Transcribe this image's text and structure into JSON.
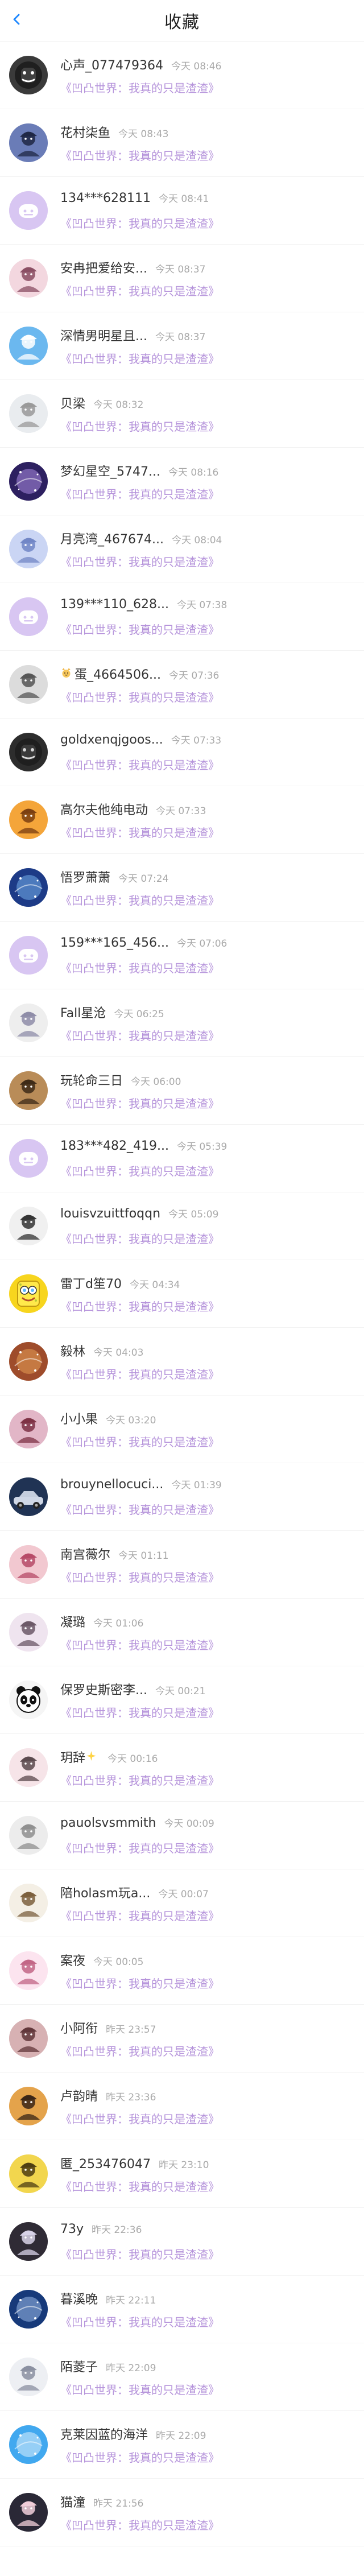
{
  "header": {
    "title": "收藏"
  },
  "items": [
    {
      "name": "心声_077479364",
      "time": "今天 08:46",
      "work": "《凹凸世界：我真的只是渣渣》",
      "avatar": {
        "bg": "#3a3a3a",
        "fg": "#ffffff",
        "style": "black"
      }
    },
    {
      "name": "花村柒鱼",
      "time": "今天 08:43",
      "work": "《凹凸世界：我真的只是渣渣》",
      "avatar": {
        "bg": "#6a7cb7",
        "fg": "#1f2744",
        "style": "anime"
      }
    },
    {
      "name": "134***628111",
      "time": "今天 08:41",
      "work": "《凹凸世界：我真的只是渣渣》",
      "avatar": {
        "bg": "#d8c6f2",
        "fg": "#ffffff",
        "style": "default"
      }
    },
    {
      "name": "安冉把爱给安...",
      "time": "今天 08:37",
      "work": "《凹凸世界：我真的只是渣渣》",
      "avatar": {
        "bg": "#f3d7df",
        "fg": "#8a4e63",
        "style": "anime"
      }
    },
    {
      "name": "深情男明星且...",
      "time": "今天 08:37",
      "work": "《凹凸世界：我真的只是渣渣》",
      "avatar": {
        "bg": "#6bb8ef",
        "fg": "#ffffff",
        "style": "anime"
      }
    },
    {
      "name": "贝梁",
      "time": "今天 08:32",
      "work": "《凹凸世界：我真的只是渣渣》",
      "avatar": {
        "bg": "#e9ecef",
        "fg": "#999999",
        "style": "anime"
      }
    },
    {
      "name": "梦幻星空_5747...",
      "time": "今天 08:16",
      "work": "《凹凸世界：我真的只是渣渣》",
      "avatar": {
        "bg": "#2d2060",
        "fg": "#c7a4ff",
        "style": "space"
      }
    },
    {
      "name": "月亮湾_467674...",
      "time": "今天 08:04",
      "work": "《凹凸世界：我真的只是渣渣》",
      "avatar": {
        "bg": "#cad5f4",
        "fg": "#7186c5",
        "style": "anime"
      }
    },
    {
      "name": "139***110_628...",
      "time": "今天 07:38",
      "work": "《凹凸世界：我真的只是渣渣》",
      "avatar": {
        "bg": "#d8c6f2",
        "fg": "#ffffff",
        "style": "default"
      }
    },
    {
      "name": "蛋_4664506...",
      "time": "今天 07:36",
      "work": "《凹凸世界：我真的只是渣渣》",
      "avatar": {
        "bg": "#dcdcdc",
        "fg": "#555555",
        "style": "anime"
      },
      "emoji": true
    },
    {
      "name": "goldxenqjgoos...",
      "time": "今天 07:33",
      "work": "《凹凸世界：我真的只是渣渣》",
      "avatar": {
        "bg": "#2d2d2d",
        "fg": "#d6d6d6",
        "style": "black"
      }
    },
    {
      "name": "高尔夫他纯电动",
      "time": "今天 07:33",
      "work": "《凹凸世界：我真的只是渣渣》",
      "avatar": {
        "bg": "#f4a53a",
        "fg": "#7a3e11",
        "style": "anime"
      }
    },
    {
      "name": "悟罗萧萧",
      "time": "今天 07:24",
      "work": "《凹凸世界：我真的只是渣渣》",
      "avatar": {
        "bg": "#1d3b87",
        "fg": "#88c8ff",
        "style": "space"
      }
    },
    {
      "name": "159***165_456...",
      "time": "今天 07:06",
      "work": "《凹凸世界：我真的只是渣渣》",
      "avatar": {
        "bg": "#d8c6f2",
        "fg": "#ffffff",
        "style": "default"
      }
    },
    {
      "name": "Fall星沧",
      "time": "今天 06:25",
      "work": "《凹凸世界：我真的只是渣渣》",
      "avatar": {
        "bg": "#eeeeee",
        "fg": "#8e8ca8",
        "style": "anime"
      }
    },
    {
      "name": "玩轮命三日",
      "time": "今天 06:00",
      "work": "《凹凸世界：我真的只是渣渣》",
      "avatar": {
        "bg": "#b98c58",
        "fg": "#3d2a17",
        "style": "anime"
      }
    },
    {
      "name": "183***482_419...",
      "time": "今天 05:39",
      "work": "《凹凸世界：我真的只是渣渣》",
      "avatar": {
        "bg": "#d8c6f2",
        "fg": "#ffffff",
        "style": "default"
      }
    },
    {
      "name": "louisvzuittfoqqn",
      "time": "今天 05:09",
      "work": "《凹凸世界：我真的只是渣渣》",
      "avatar": {
        "bg": "#f0f0f0",
        "fg": "#333333",
        "style": "anime"
      }
    },
    {
      "name": "雷丁d笙70",
      "time": "今天 04:34",
      "work": "《凹凸世界：我真的只是渣渣》",
      "avatar": {
        "bg": "#f7d51e",
        "fg": "#7b4d10",
        "style": "sponge"
      }
    },
    {
      "name": "毅林",
      "time": "今天 04:03",
      "work": "《凹凸世界：我真的只是渣渣》",
      "avatar": {
        "bg": "#9e4c2b",
        "fg": "#f4b25f",
        "style": "space"
      }
    },
    {
      "name": "小小果",
      "time": "今天 03:20",
      "work": "《凹凸世界：我真的只是渣渣》",
      "avatar": {
        "bg": "#e2b6c7",
        "fg": "#7d3145",
        "style": "anime"
      }
    },
    {
      "name": "brouynellocuci...",
      "time": "今天 01:39",
      "work": "《凹凸世界：我真的只是渣渣》",
      "avatar": {
        "bg": "#203354",
        "fg": "#cfd7e6",
        "style": "car"
      }
    },
    {
      "name": "南宫薇尔",
      "time": "今天 01:11",
      "work": "《凹凸世界：我真的只是渣渣》",
      "avatar": {
        "bg": "#f2c8d0",
        "fg": "#b64a67",
        "style": "anime"
      }
    },
    {
      "name": "凝璐",
      "time": "今天 01:06",
      "work": "《凹凸世界：我真的只是渣渣》",
      "avatar": {
        "bg": "#efe4ef",
        "fg": "#6b5867",
        "style": "anime"
      }
    },
    {
      "name": "保罗史斯密李...",
      "time": "今天 00:21",
      "work": "《凹凸世界：我真的只是渣渣》",
      "avatar": {
        "bg": "#f5f5f5",
        "fg": "#111111",
        "style": "panda"
      }
    },
    {
      "name": "玥辞",
      "time": "今天 00:16",
      "work": "《凹凸世界：我真的只是渣渣》",
      "avatar": {
        "bg": "#f6e4e8",
        "fg": "#5b4a4e",
        "style": "anime"
      },
      "suffix_star": true
    },
    {
      "name": "pauolsvsmmith",
      "time": "今天 00:09",
      "work": "《凹凸世界：我真的只是渣渣》",
      "avatar": {
        "bg": "#ececec",
        "fg": "#8f8f8f",
        "style": "anime"
      }
    },
    {
      "name": "陪holasm玩a...",
      "time": "今天 00:07",
      "work": "《凹凸世界：我真的只是渣渣》",
      "avatar": {
        "bg": "#f4efe5",
        "fg": "#7b5f3d",
        "style": "anime"
      }
    },
    {
      "name": "案夜",
      "time": "今天 00:05",
      "work": "《凹凸世界：我真的只是渣渣》",
      "avatar": {
        "bg": "#fce4ef",
        "fg": "#c26686",
        "style": "anime"
      }
    },
    {
      "name": "小阿衔",
      "time": "昨天 23:57",
      "work": "《凹凸世界：我真的只是渣渣》",
      "avatar": {
        "bg": "#d7b1b3",
        "fg": "#61373a",
        "style": "anime"
      }
    },
    {
      "name": "卢韵晴",
      "time": "昨天 23:36",
      "work": "《凹凸世界：我真的只是渣渣》",
      "avatar": {
        "bg": "#e4a34b",
        "fg": "#3a2516",
        "style": "anime"
      }
    },
    {
      "name": "匿_253476047",
      "time": "昨天 23:10",
      "work": "《凹凸世界：我真的只是渣渣》",
      "avatar": {
        "bg": "#f2d64e",
        "fg": "#4d3d13",
        "style": "anime"
      }
    },
    {
      "name": "73y",
      "time": "昨天 22:36",
      "work": "《凹凸世界：我真的只是渣渣》",
      "avatar": {
        "bg": "#2f2b35",
        "fg": "#d8d3e8",
        "style": "anime"
      }
    },
    {
      "name": "暮溪晚",
      "time": "昨天 22:11",
      "work": "《凹凸世界：我真的只是渣渣》",
      "avatar": {
        "bg": "#173a7a",
        "fg": "#b8d7ff",
        "style": "space"
      }
    },
    {
      "name": "陌菱子",
      "time": "昨天 22:09",
      "work": "《凹凸世界：我真的只是渣渣》",
      "avatar": {
        "bg": "#edeff3",
        "fg": "#8a8fa0",
        "style": "anime"
      }
    },
    {
      "name": "克莱因蓝的海洋",
      "time": "昨天 22:09",
      "work": "《凹凸世界：我真的只是渣渣》",
      "avatar": {
        "bg": "#41a8ef",
        "fg": "#ffffff",
        "style": "space"
      }
    },
    {
      "name": "猫潼",
      "time": "昨天 21:56",
      "work": "《凹凸世界：我真的只是渣渣》",
      "avatar": {
        "bg": "#2a2836",
        "fg": "#f1cfda",
        "style": "anime"
      }
    }
  ],
  "colors": {
    "accent_blue": "#1e88ff",
    "work_purple": "#b694db",
    "time_gray": "#a9a9a9",
    "divider": "#f2f2f2"
  }
}
